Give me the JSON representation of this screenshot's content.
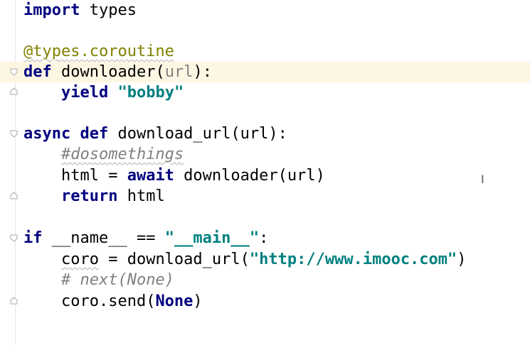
{
  "editor": {
    "lines": [
      {
        "kw": "import",
        "rest": " types"
      },
      {
        "deco": "@types.coroutine"
      },
      {
        "kw": "def",
        "name": " downloader(",
        "param": "url",
        "end": "):"
      },
      {
        "indent": "    ",
        "kw": "yield",
        "sp": " ",
        "str": "\"bobby\""
      },
      {
        "kw": "async def",
        "rest": " download_url(url):"
      },
      {
        "indent": "    ",
        "comment": "#dosomethings"
      },
      {
        "indent": "    ",
        "pre": "html = ",
        "kw": "await",
        "rest": " downloader(url)"
      },
      {
        "indent": "    ",
        "kw": "return",
        "rest": " html"
      },
      {
        "kw": "if",
        "pre": " __name__ == ",
        "str": "\"__main__\"",
        "end": ":"
      },
      {
        "indent": "    ",
        "pre": "coro",
        "mid": " = download_url(",
        "str": "\"http://www.imooc.com\"",
        "end": ")"
      },
      {
        "indent": "    ",
        "comment": "# next(None)"
      },
      {
        "indent": "    ",
        "pre": "coro.send(",
        "kw": "None",
        "end": ")"
      }
    ],
    "cursor_glyph": "I",
    "colors": {
      "keyword": "#000080",
      "string": "#008080",
      "decorator": "#808000",
      "comment": "#808080",
      "caret_row": "#fdf6e3"
    }
  }
}
